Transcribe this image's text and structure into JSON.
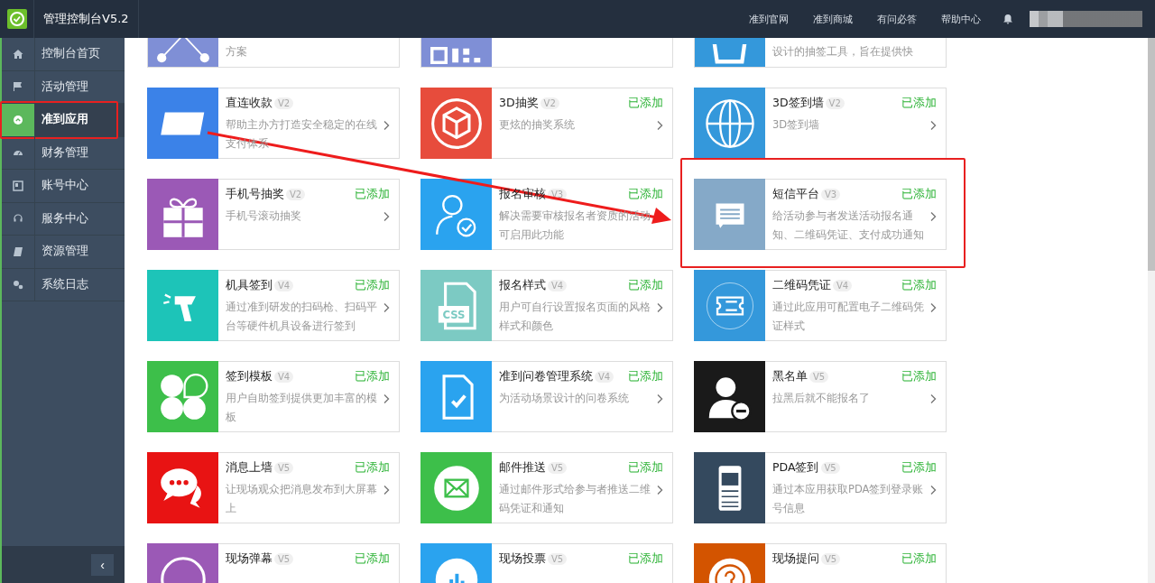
{
  "header": {
    "title": "管理控制台V5.2",
    "links": [
      "准到官网",
      "准到商城",
      "有问必答",
      "帮助中心"
    ]
  },
  "sidebar": {
    "items": [
      {
        "label": "控制台首页",
        "kind": "home",
        "selected": false,
        "highlighted": false
      },
      {
        "label": "活动管理",
        "kind": "flag",
        "selected": false,
        "highlighted": false
      },
      {
        "label": "准到应用",
        "kind": "apps",
        "selected": true,
        "highlighted": true
      },
      {
        "label": "财务管理",
        "kind": "gauge",
        "selected": false,
        "highlighted": false
      },
      {
        "label": "账号中心",
        "kind": "account",
        "selected": false,
        "highlighted": false
      },
      {
        "label": "服务中心",
        "kind": "headset",
        "selected": false,
        "highlighted": false
      },
      {
        "label": "资源管理",
        "kind": "book",
        "selected": false,
        "highlighted": false
      },
      {
        "label": "系统日志",
        "kind": "gears",
        "selected": false,
        "highlighted": false
      }
    ],
    "collapse": "‹"
  },
  "apps": {
    "rows": [
      {
        "clipped": true,
        "cards": [
          {
            "color": "#7f8fd6",
            "kind": "network",
            "desc": "方案",
            "highlighted": false
          },
          {
            "color": "#7f8fd6",
            "kind": "qr",
            "highlighted": false
          },
          {
            "color": "#3498db",
            "kind": "cup",
            "desc": "设计的抽签工具，旨在提供快",
            "highlighted": false
          }
        ]
      },
      {
        "clipped": false,
        "cards": [
          {
            "color": "#3b82e8",
            "kind": "bankcard",
            "title": "直连收款",
            "version": "V2",
            "desc": "帮助主办方打造安全稳定的在线支付体系",
            "highlighted": false
          },
          {
            "color": "#e74c3c",
            "kind": "cube",
            "title": "3D抽奖",
            "version": "V2",
            "status": "已添加",
            "desc": "更炫的抽奖系统",
            "highlighted": false
          },
          {
            "color": "#3498db",
            "kind": "globe",
            "title": "3D签到墙",
            "version": "V2",
            "status": "已添加",
            "desc": "3D签到墙",
            "highlighted": false
          }
        ]
      },
      {
        "clipped": false,
        "cards": [
          {
            "color": "#9b59b6",
            "kind": "gift",
            "title": "手机号抽奖",
            "version": "V2",
            "status": "已添加",
            "desc": "手机号滚动抽奖",
            "highlighted": false
          },
          {
            "color": "#2aa3ef",
            "kind": "usercheck",
            "title": "报名审核",
            "version": "V3",
            "status": "已添加",
            "desc": "解决需要审核报名者资质的活动可启用此功能",
            "highlighted": false
          },
          {
            "color": "#85a9c8",
            "kind": "message",
            "title": "短信平台",
            "version": "V3",
            "status": "已添加",
            "desc": "给活动参与者发送活动报名通知、二维码凭证、支付成功通知",
            "highlighted": true
          }
        ]
      },
      {
        "clipped": false,
        "cards": [
          {
            "color": "#1dc4b8",
            "kind": "scanner",
            "title": "机具签到",
            "version": "V4",
            "status": "已添加",
            "desc": "通过准到研发的扫码枪、扫码平台等硬件机具设备进行签到",
            "highlighted": false
          },
          {
            "color": "#7ccac3",
            "kind": "file",
            "icon_label": "CSS",
            "title": "报名样式",
            "version": "V4",
            "status": "已添加",
            "desc": "用户可自行设置报名页面的风格样式和颜色",
            "highlighted": false
          },
          {
            "color": "#3498db",
            "kind": "ticket",
            "title": "二维码凭证",
            "version": "V4",
            "status": "已添加",
            "desc": "通过此应用可配置电子二维码凭证样式",
            "highlighted": false
          }
        ]
      },
      {
        "clipped": false,
        "cards": [
          {
            "color": "#3dbf4a",
            "kind": "clover",
            "title": "签到模板",
            "version": "V4",
            "status": "已添加",
            "desc": "用户自助签到提供更加丰富的模板",
            "highlighted": false
          },
          {
            "color": "#2aa3ef",
            "kind": "doccheck",
            "title": "准到问卷管理系统",
            "version": "V4",
            "status": "已添加",
            "desc": "为活动场景设计的问卷系统",
            "highlighted": false
          },
          {
            "color": "#1a1a1a",
            "kind": "userminus",
            "title": "黑名单",
            "version": "V5",
            "status": "已添加",
            "desc": "拉黑后就不能报名了",
            "highlighted": false
          }
        ]
      },
      {
        "clipped": false,
        "cards": [
          {
            "color": "#e81313",
            "kind": "chat",
            "title": "消息上墙",
            "version": "V5",
            "status": "已添加",
            "desc": "让现场观众把消息发布到大屏幕上",
            "highlighted": false
          },
          {
            "color": "#3dbf4a",
            "kind": "mail",
            "title": "邮件推送",
            "version": "V5",
            "status": "已添加",
            "desc": "通过邮件形式给参与者推送二维码凭证和通知",
            "highlighted": false
          },
          {
            "color": "#34495e",
            "kind": "phone",
            "title": "PDA签到",
            "version": "V5",
            "status": "已添加",
            "desc": "通过本应用获取PDA签到登录账号信息",
            "highlighted": false
          }
        ]
      },
      {
        "clipped": false,
        "cards": [
          {
            "color": "#9b59b6",
            "kind": "circletext",
            "title": "现场弹幕",
            "version": "V5",
            "status": "已添加",
            "highlighted": false
          },
          {
            "color": "#2aa3ef",
            "kind": "bars",
            "title": "现场投票",
            "version": "V5",
            "status": "已添加",
            "highlighted": false
          },
          {
            "color": "#d35400",
            "kind": "question",
            "title": "现场提问",
            "version": "V5",
            "status": "已添加",
            "highlighted": false
          }
        ]
      }
    ]
  }
}
